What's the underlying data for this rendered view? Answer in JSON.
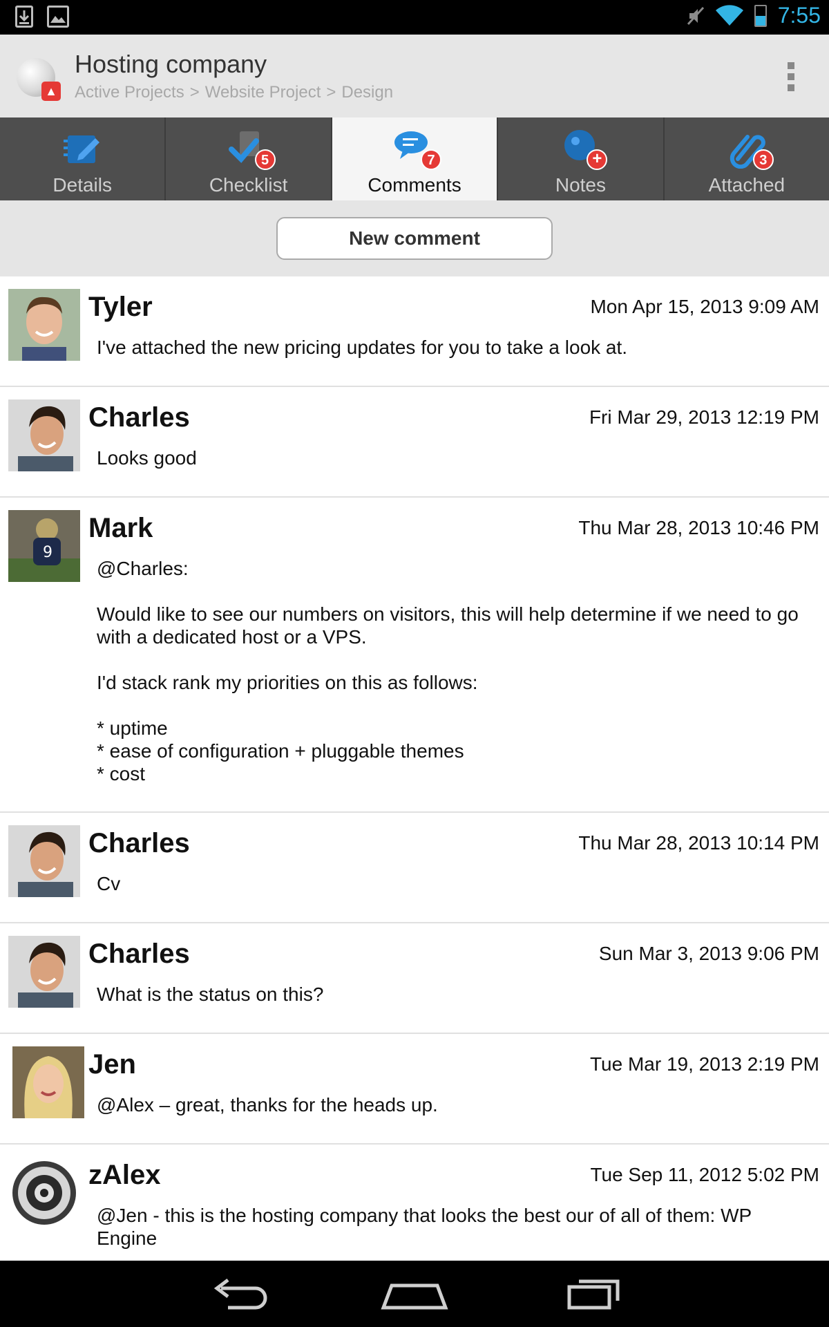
{
  "status_bar": {
    "time": "7:55",
    "left_icons": [
      "download-icon",
      "image-icon"
    ],
    "right_icons": [
      "mute-icon",
      "wifi-icon",
      "battery-icon"
    ],
    "battery_level": 0.5,
    "accent_color": "#33b5e5"
  },
  "action_bar": {
    "title": "Hosting company",
    "breadcrumb": [
      "Active Projects",
      ">",
      "Website Project",
      ">",
      "Design"
    ]
  },
  "tabs": [
    {
      "label": "Details",
      "icon": "details-icon",
      "badge": "",
      "active": false
    },
    {
      "label": "Checklist",
      "icon": "checklist-icon",
      "badge": "5",
      "active": false
    },
    {
      "label": "Comments",
      "icon": "comments-icon",
      "badge": "7",
      "active": true
    },
    {
      "label": "Notes",
      "icon": "notes-icon",
      "badge": "+",
      "active": false
    },
    {
      "label": "Attached",
      "icon": "paperclip-icon",
      "badge": "3",
      "active": false
    }
  ],
  "new_comment_label": "New comment",
  "comments": [
    {
      "author": "Tyler",
      "timestamp": "Mon Apr 15, 2013 9:09 AM",
      "body": "I've attached the new pricing updates for you to take a look at.",
      "avatar": "tyler-avatar"
    },
    {
      "author": "Charles",
      "timestamp": "Fri Mar 29, 2013 12:19 PM",
      "body": "Looks good",
      "avatar": "charles-avatar"
    },
    {
      "author": "Mark",
      "timestamp": "Thu Mar 28, 2013 10:46 PM",
      "body": "@Charles:\n\nWould like to see our numbers on visitors, this will help determine if we need to go with a dedicated host or a VPS.\n\nI'd stack rank my priorities on this as follows:\n\n* uptime\n* ease of configuration + pluggable themes\n* cost",
      "avatar": "mark-avatar"
    },
    {
      "author": "Charles",
      "timestamp": "Thu Mar 28, 2013 10:14 PM",
      "body": "Cv",
      "avatar": "charles-avatar"
    },
    {
      "author": "Charles",
      "timestamp": "Sun Mar 3, 2013 9:06 PM",
      "body": "What is the status on this?",
      "avatar": "charles-avatar"
    },
    {
      "author": "Jen",
      "timestamp": "Tue Mar 19, 2013 2:19 PM",
      "body": "@Alex – great, thanks for the heads up.",
      "avatar": "jen-avatar"
    },
    {
      "author": "zAlex",
      "timestamp": "Tue Sep 11, 2012 5:02 PM",
      "body": "@Jen - this is the hosting company that looks the best our of all of them: WP Engine",
      "avatar": "roomba-avatar"
    }
  ],
  "nav_bar": {
    "buttons": [
      "back-icon",
      "home-icon",
      "recents-icon"
    ]
  }
}
